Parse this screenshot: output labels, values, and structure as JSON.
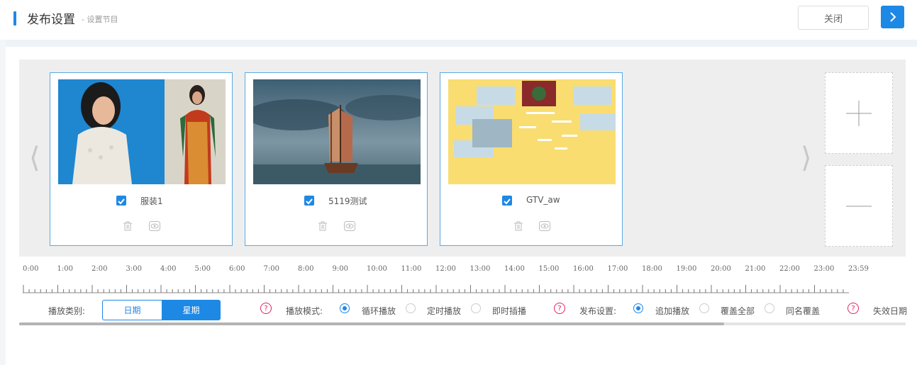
{
  "header": {
    "title": "发布设置",
    "subtitle": "- 设置节目",
    "close_label": "关闭",
    "next_icon": "chevron-right-icon",
    "accent": "#1e88e5"
  },
  "gallery": {
    "items": [
      {
        "name": "服装1",
        "checked": true
      },
      {
        "name": "5119测试",
        "checked": true
      },
      {
        "name": "GTV_aw",
        "checked": true
      }
    ],
    "add_icon": "plus-icon",
    "remove_icon": "minus-icon"
  },
  "timeline": {
    "ticks": [
      "0:00",
      "1:00",
      "2:00",
      "3:00",
      "4:00",
      "5:00",
      "6:00",
      "7:00",
      "8:00",
      "9:00",
      "10:00",
      "11:00",
      "12:00",
      "13:00",
      "14:00",
      "15:00",
      "16:00",
      "17:00",
      "18:00",
      "19:00",
      "20:00",
      "21:00",
      "22:00",
      "23:00",
      "23:59"
    ]
  },
  "controls": {
    "play_type_label": "播放类别:",
    "play_type_options": [
      "日期",
      "星期"
    ],
    "play_type_selected": "星期",
    "play_mode_label": "播放模式:",
    "play_mode_options": [
      "循环播放",
      "定时播放",
      "即时插播"
    ],
    "play_mode_selected": "循环播放",
    "publish_label": "发布设置:",
    "publish_options": [
      "追加播放",
      "覆盖全部",
      "同名覆盖"
    ],
    "publish_selected": "追加播放",
    "expire_label": "失效日期"
  }
}
